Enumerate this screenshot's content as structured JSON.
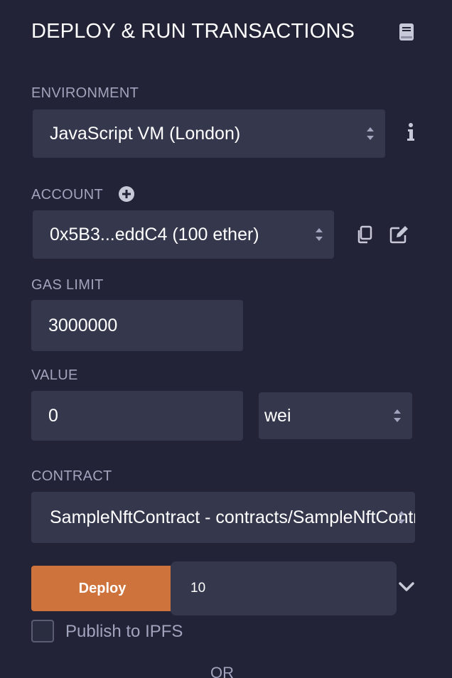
{
  "header": {
    "title": "DEPLOY & RUN TRANSACTIONS",
    "docs_icon": "book-icon"
  },
  "environment": {
    "label": "ENVIRONMENT",
    "value": "JavaScript VM (London)",
    "info_icon": "info-icon"
  },
  "account": {
    "label": "ACCOUNT",
    "add_icon": "plus-circle-icon",
    "value": "0x5B3...eddC4 (100 ether)",
    "copy_icon": "copy-icon",
    "edit_icon": "edit-icon"
  },
  "gas_limit": {
    "label": "GAS LIMIT",
    "value": "3000000"
  },
  "value": {
    "label": "VALUE",
    "amount": "0",
    "unit": "wei"
  },
  "contract": {
    "label": "CONTRACT",
    "value": "SampleNftContract - contracts/SampleNftContract.sol"
  },
  "deploy": {
    "button_label": "Deploy",
    "input_value": "10",
    "expand_icon": "chevron-down-icon"
  },
  "publish": {
    "label": "Publish to IPFS",
    "checked": false
  },
  "separator": {
    "label": "OR"
  },
  "colors": {
    "background": "#222336",
    "field": "#35384d",
    "label": "#a2a3bd",
    "deploy_button": "#cd733b"
  }
}
